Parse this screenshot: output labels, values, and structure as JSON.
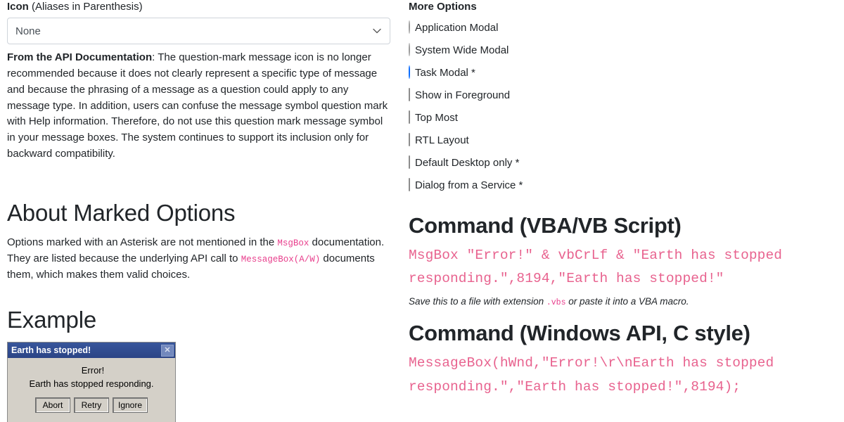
{
  "left": {
    "icon_field": {
      "label_strong": "Icon",
      "label_rest": " (Aliases in Parenthesis)",
      "selected": "None",
      "options": [
        "None"
      ],
      "chevron_icon": "chevron-down-icon"
    },
    "api_note": {
      "lead": "From the API Documentation",
      "separator": ": ",
      "text": "The question-mark message icon is no longer recommended because it does not clearly represent a specific type of message and because the phrasing of a message as a question could apply to any message type. In addition, users can confuse the message symbol question mark with Help information. Therefore, do not use this question mark message symbol in your message boxes. The system continues to support its inclusion only for backward compatibility."
    },
    "about_marked": {
      "heading": "About Marked Options",
      "text_part1": "Options marked with an Asterisk are not mentioned in the ",
      "code1": "MsgBox",
      "text_part2": " documentation. They are listed because the underlying API call to ",
      "code2": "MessageBox(A/W)",
      "text_part3": " documents them, which makes them valid choices."
    },
    "example": {
      "heading": "Example",
      "dialog": {
        "title": "Earth has stopped!",
        "close_label": "✕",
        "line1": "Error!",
        "line2": "Earth has stopped responding.",
        "buttons": [
          "Abort",
          "Retry",
          "Ignore"
        ]
      }
    }
  },
  "right": {
    "more_options": {
      "title": "More Options",
      "items": [
        {
          "type": "radio",
          "label": "Application Modal",
          "checked": false,
          "marked": false
        },
        {
          "type": "radio",
          "label": "System Wide Modal",
          "checked": false,
          "marked": false
        },
        {
          "type": "radio",
          "label": "Task Modal *",
          "checked": true,
          "marked": true
        },
        {
          "type": "checkbox",
          "label": "Show in Foreground",
          "checked": false,
          "marked": false
        },
        {
          "type": "checkbox",
          "label": "Top Most",
          "checked": false,
          "marked": false
        },
        {
          "type": "checkbox",
          "label": "RTL Layout",
          "checked": false,
          "marked": false
        },
        {
          "type": "checkbox",
          "label": "Default Desktop only *",
          "checked": false,
          "marked": true
        },
        {
          "type": "checkbox",
          "label": "Dialog from a Service *",
          "checked": false,
          "marked": true
        }
      ]
    },
    "command_vba": {
      "heading": "Command (VBA/VB Script)",
      "code": "MsgBox \"Error!\" & vbCrLf & \"Earth has stopped responding.\",8194,\"Earth has stopped!\"",
      "caption_part1": "Save this to a file with extension ",
      "caption_code": ".vbs",
      "caption_part2": " or paste it into a VBA macro."
    },
    "command_api": {
      "heading": "Command (Windows API, C style)",
      "code": "MessageBox(hWnd,\"Error!\\r\\nEarth has stopped responding.\",\"Earth has stopped!\",8194);"
    }
  },
  "colors": {
    "code_pink": "#e8638f",
    "inline_code_pink": "#e83e8c",
    "accent_blue": "#0d6efd",
    "dialog_titlebar": "#2e4d8e",
    "dialog_face": "#d4d0c8",
    "border_gray": "#ced4da"
  }
}
